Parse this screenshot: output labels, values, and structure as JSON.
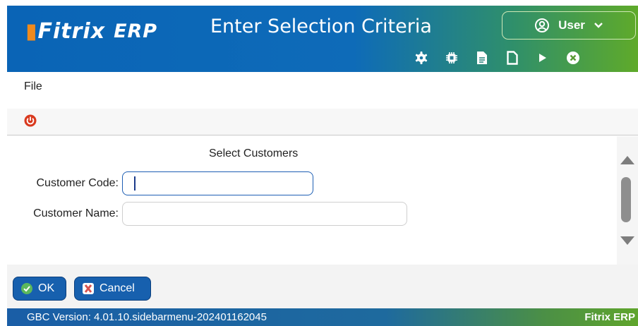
{
  "header": {
    "logo_main": "Fitrix",
    "logo_suffix": "ERP",
    "title": "Enter Selection Criteria",
    "user_label": "User",
    "toolbar_icons": [
      "gear-icon",
      "chip-icon",
      "document-text-icon",
      "document-icon",
      "play-icon",
      "close-circle-icon"
    ]
  },
  "menu": {
    "file_label": "File"
  },
  "form": {
    "title": "Select Customers",
    "customer_code_label": "Customer Code:",
    "customer_code_value": "",
    "customer_name_label": "Customer Name:",
    "customer_name_value": ""
  },
  "buttons": {
    "ok_label": "OK",
    "cancel_label": "Cancel"
  },
  "status": {
    "version": "GBC Version: 4.01.10.sidebarmenu-202401162045",
    "product": "Fitrix ERP"
  },
  "colors": {
    "header_blue": "#0a64b6",
    "header_green": "#5faa2a",
    "logo_orange": "#f08a1c",
    "button_blue": "#1760ae",
    "power_red": "#d93a1f",
    "ok_green": "#5cb85c",
    "cancel_red": "#d9534f"
  }
}
